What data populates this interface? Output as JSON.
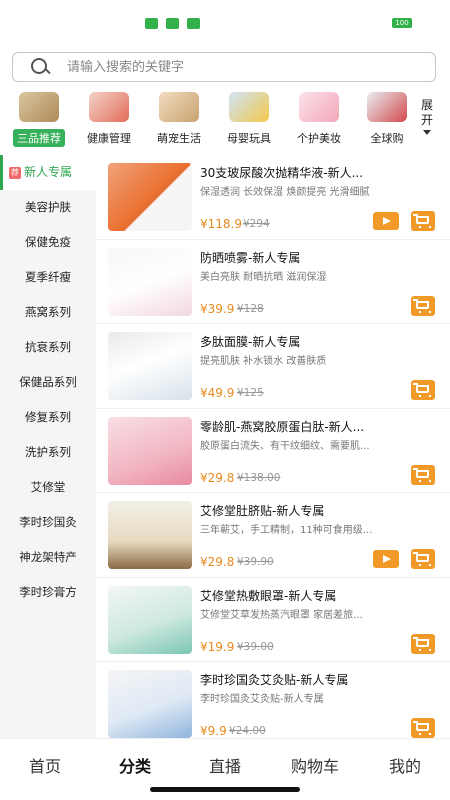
{
  "status_bar": {
    "battery": "100"
  },
  "search": {
    "placeholder": "请输入搜索的关键字"
  },
  "categories": [
    {
      "label": "三品推荐",
      "active": true
    },
    {
      "label": "健康管理"
    },
    {
      "label": "萌宠生活"
    },
    {
      "label": "母婴玩具"
    },
    {
      "label": "个护美妆"
    },
    {
      "label": "全球购"
    }
  ],
  "expand_label": "展开",
  "sidebar": {
    "tag": "荐",
    "items": [
      {
        "label": "新人专属",
        "active": true
      },
      {
        "label": "美容护肤"
      },
      {
        "label": "保健免疫"
      },
      {
        "label": "夏季纤瘦"
      },
      {
        "label": "燕窝系列"
      },
      {
        "label": "抗衰系列"
      },
      {
        "label": "保健品系列"
      },
      {
        "label": "修复系列"
      },
      {
        "label": "洗护系列"
      },
      {
        "label": "艾修堂"
      },
      {
        "label": "李时珍国灸"
      },
      {
        "label": "神龙架特产"
      },
      {
        "label": "李时珍膏方"
      }
    ]
  },
  "products": [
    {
      "title": "30支玻尿酸次抛精华液-新人...",
      "subtitle": "保湿透润 长效保湿 焕颜提亮 光滑细腻",
      "price": "¥118.9",
      "old_price": "¥294",
      "has_video": true
    },
    {
      "title": "防晒喷雾-新人专属",
      "subtitle": "美白亮肤 耐晒抗晒 滋润保湿",
      "price": "¥39.9",
      "old_price": "¥128",
      "has_video": false
    },
    {
      "title": "多肽面膜-新人专属",
      "subtitle": "提亮肌肤 补水锁水 改善肤质",
      "price": "¥49.9",
      "old_price": "¥125",
      "has_video": false
    },
    {
      "title": "零龄肌-燕窝胶原蛋白肽-新人...",
      "subtitle": "胶原蛋白流失、有干纹细纹、需要肌...",
      "price": "¥29.8",
      "old_price": "¥138.00",
      "has_video": false
    },
    {
      "title": "艾修堂肚脐贴-新人专属",
      "subtitle": "三年蕲艾，手工精制，11种可食用级...",
      "price": "¥29.8",
      "old_price": "¥39.90",
      "has_video": true
    },
    {
      "title": "艾修堂热敷眼罩-新人专属",
      "subtitle": "艾修堂艾草发热蒸汽眼罩 家居差旅...",
      "price": "¥19.9",
      "old_price": "¥39.00",
      "has_video": false
    },
    {
      "title": "李时珍国灸艾灸贴-新人专属",
      "subtitle": "李时珍国灸艾灸贴-新人专属",
      "price": "¥9.9",
      "old_price": "¥24.00",
      "has_video": false
    }
  ],
  "bottom_nav": [
    {
      "label": "首页"
    },
    {
      "label": "分类",
      "active": true
    },
    {
      "label": "直播"
    },
    {
      "label": "购物车"
    },
    {
      "label": "我的"
    }
  ],
  "colors": {
    "accent_green": "#2fa64f",
    "price_orange": "#e88a1e",
    "button_orange": "#f29a29"
  },
  "icons": {
    "search": "search-icon",
    "cart": "cart-icon",
    "play": "play-icon",
    "expand": "chevron-down-icon"
  }
}
